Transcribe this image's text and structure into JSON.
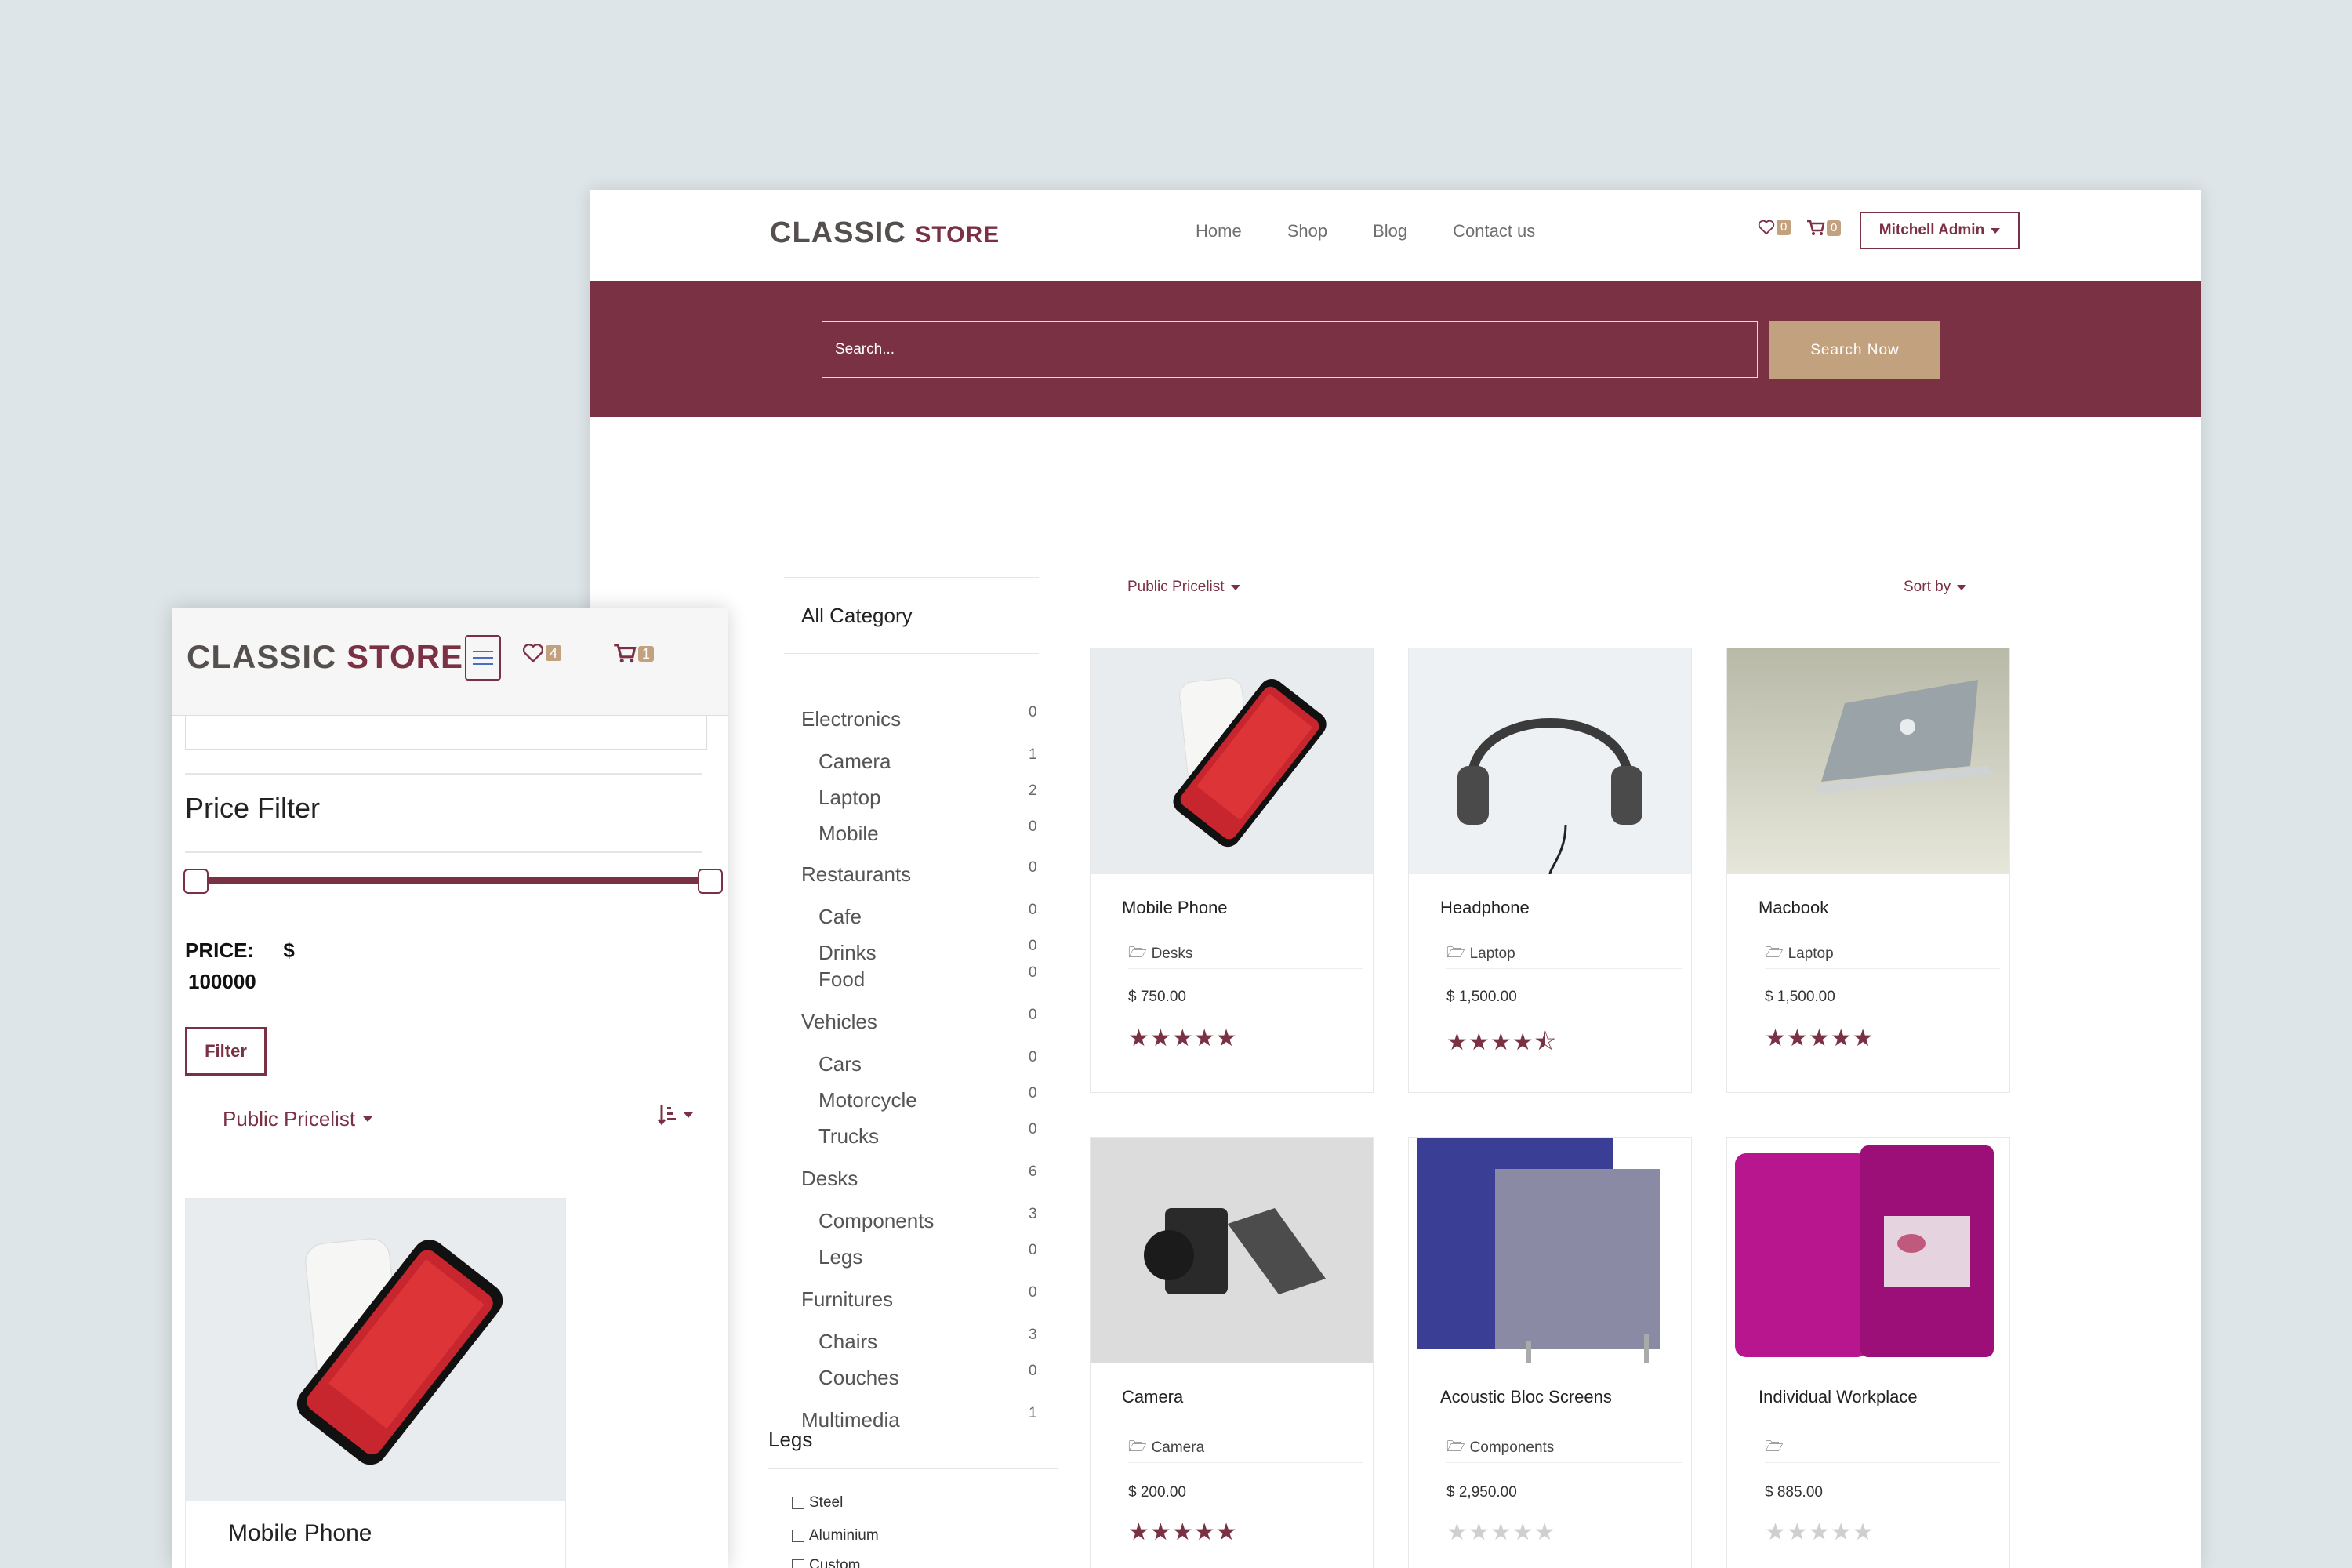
{
  "brand": {
    "word1": "CLASSIC",
    "word2": "STORE"
  },
  "nav": {
    "items": [
      "Home",
      "Shop",
      "Blog",
      "Contact us"
    ],
    "wishlist_count": "0",
    "cart_count": "0",
    "user": "Mitchell Admin"
  },
  "search": {
    "placeholder": "Search...",
    "button": "Search Now"
  },
  "sidebar": {
    "title": "All Category",
    "categories": [
      {
        "name": "Electronics",
        "count": "0"
      },
      {
        "name": "Camera",
        "count": "1"
      },
      {
        "name": "Laptop",
        "count": "2"
      },
      {
        "name": "Mobile",
        "count": "0"
      },
      {
        "name": "Restaurants",
        "count": "0"
      },
      {
        "name": "Cafe",
        "count": "0"
      },
      {
        "name": "Drinks",
        "count": "0"
      },
      {
        "name": "Food",
        "count": "0"
      },
      {
        "name": "Vehicles",
        "count": "0"
      },
      {
        "name": "Cars",
        "count": "0"
      },
      {
        "name": "Motorcycle",
        "count": "0"
      },
      {
        "name": "Trucks",
        "count": "0"
      },
      {
        "name": "Desks",
        "count": "6"
      },
      {
        "name": "Components",
        "count": "3"
      },
      {
        "name": "Legs",
        "count": "0"
      },
      {
        "name": "Furnitures",
        "count": "0"
      },
      {
        "name": "Chairs",
        "count": "3"
      },
      {
        "name": "Couches",
        "count": "0"
      },
      {
        "name": "Multimedia",
        "count": "1"
      }
    ],
    "legs_title": "Legs",
    "legs_options": [
      "Steel",
      "Aluminium",
      "Custom"
    ]
  },
  "toolbar": {
    "pricelist": "Public Pricelist",
    "sort": "Sort by"
  },
  "products": [
    {
      "name": "Mobile Phone",
      "category": "Desks",
      "price": "$ 750.00",
      "rating": 5
    },
    {
      "name": "Headphone",
      "category": "Laptop",
      "price": "$ 1,500.00",
      "rating": 4.5
    },
    {
      "name": "Macbook",
      "category": "Laptop",
      "price": "$ 1,500.00",
      "rating": 5
    },
    {
      "name": "Camera",
      "category": "Camera",
      "price": "$ 200.00",
      "rating": 5
    },
    {
      "name": "Acoustic Bloc Screens",
      "category": "Components",
      "price": "$ 2,950.00",
      "rating": 0
    },
    {
      "name": "Individual Workplace",
      "category": "",
      "price": "$ 885.00",
      "rating": 0
    }
  ],
  "mobile": {
    "wishlist_count": "4",
    "cart_count": "1",
    "price_filter_title": "Price Filter",
    "price_label": "PRICE:",
    "currency": "$",
    "price_value": "100000",
    "filter_button": "Filter",
    "pricelist": "Public Pricelist",
    "product_name": "Mobile Phone"
  },
  "colors": {
    "brand": "#7a3144",
    "accent": "#c2a17f",
    "background": "#dde5e8"
  }
}
